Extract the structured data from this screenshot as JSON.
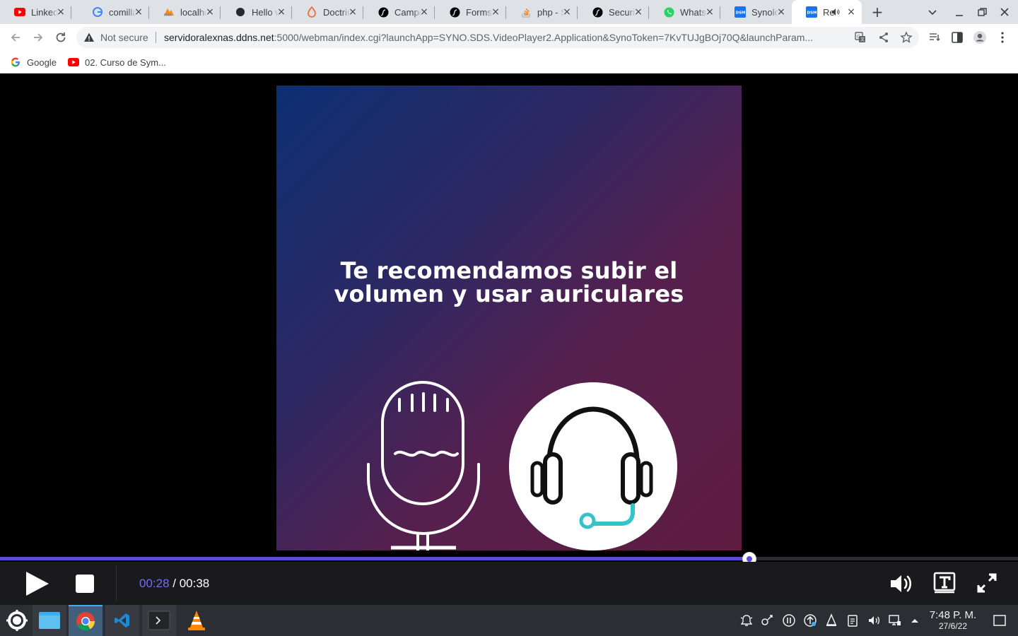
{
  "tabs": [
    {
      "title": "LinkedIn",
      "icon": "youtube-icon"
    },
    {
      "title": "comillas",
      "icon": "google-icon"
    },
    {
      "title": "localhost",
      "icon": "phpmyadmin-icon"
    },
    {
      "title": "Hello world",
      "icon": "github-icon"
    },
    {
      "title": "Doctrine",
      "icon": "doctrine-icon"
    },
    {
      "title": "Campos",
      "icon": "symfony-icon"
    },
    {
      "title": "Forms",
      "icon": "symfony-icon"
    },
    {
      "title": "php - Stack",
      "icon": "stackoverflow-icon"
    },
    {
      "title": "Security",
      "icon": "symfony-icon"
    },
    {
      "title": "WhatsApp",
      "icon": "whatsapp-icon"
    },
    {
      "title": "Synology",
      "icon": "dsm-icon"
    },
    {
      "title": "Re",
      "icon": "dsm-icon",
      "active": true,
      "audio": true
    }
  ],
  "toolbar": {
    "security_label": "Not secure",
    "url_host": "servidoralexnas.ddns.net",
    "url_rest": ":5000/webman/index.cgi?launchApp=SYNO.SDS.VideoPlayer2.Application&SynoToken=7KvTUJgBOj70Q&launchParam..."
  },
  "bookmarks": [
    {
      "label": "Google",
      "icon": "google-icon"
    },
    {
      "label": "02. Curso de Sym...",
      "icon": "youtube-icon"
    }
  ],
  "video": {
    "headline_line1": "Te recomendamos subir el",
    "headline_line2": "volumen y usar auriculares"
  },
  "player": {
    "current_time": "00:28",
    "separator": " / ",
    "total_time": "00:38",
    "progress_fraction": 0.736,
    "accent": "#5b4bd6"
  },
  "taskbar": {
    "clock_time": "7:48 P. M.",
    "clock_date": "27/6/22"
  }
}
